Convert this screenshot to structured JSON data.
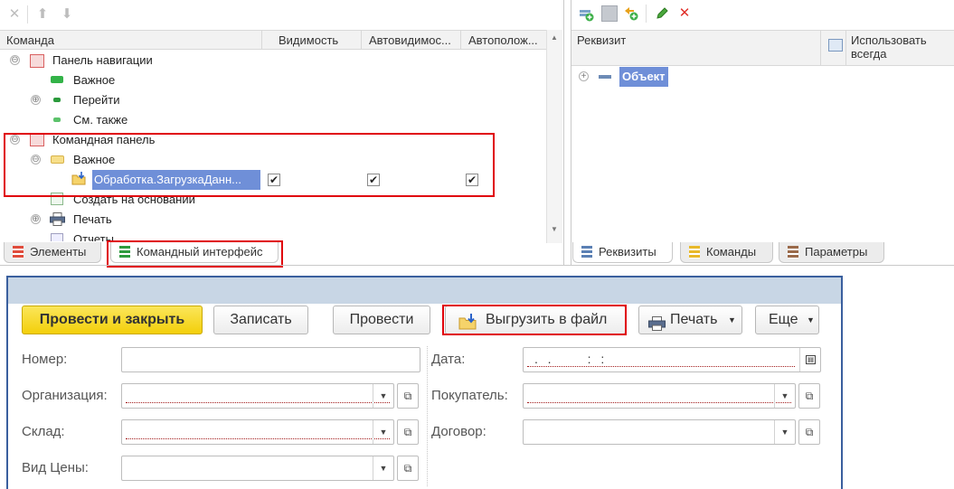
{
  "left_panel": {
    "columns": [
      "Команда",
      "Видимость",
      "Автовидимос...",
      "Автополож..."
    ],
    "tree": [
      {
        "label": "Панель навигации",
        "expander": "⊖"
      },
      {
        "label": "Важное"
      },
      {
        "label": "Перейти",
        "expander": "⊕"
      },
      {
        "label": "См. также"
      },
      {
        "label": "Командная панель",
        "expander": "⊖"
      },
      {
        "label": "Важное",
        "expander": "⊖"
      },
      {
        "label": "Обработка.ЗагрузкаДанн..."
      },
      {
        "label": "Создать на основании"
      },
      {
        "label": "Печать",
        "expander": "⊕"
      },
      {
        "label": "Отчеты"
      }
    ],
    "tabs": [
      "Элементы",
      "Командный интерфейс"
    ]
  },
  "right_panel": {
    "columns": [
      "Реквизит",
      "Использовать всегда"
    ],
    "root_item": "Объект",
    "tabs": [
      "Реквизиты",
      "Команды",
      "Параметры"
    ]
  },
  "form": {
    "buttons": {
      "post_close": "Провести и закрыть",
      "write": "Записать",
      "post": "Провести",
      "export": "Выгрузить в файл",
      "print": "Печать",
      "more": "Еще"
    },
    "labels": {
      "number": "Номер:",
      "date": "Дата:",
      "org": "Организация:",
      "buyer": "Покупатель:",
      "warehouse": "Склад:",
      "contract": "Договор:",
      "price_type": "Вид Цены:"
    },
    "date_mask": ".  .        :  :"
  },
  "colors": {
    "selection": "#6f8fd8",
    "highlight_box": "#e0000a",
    "primary_button": "#f5d41b",
    "form_border": "#3a5f9e",
    "form_title": "#c8d6e5"
  }
}
